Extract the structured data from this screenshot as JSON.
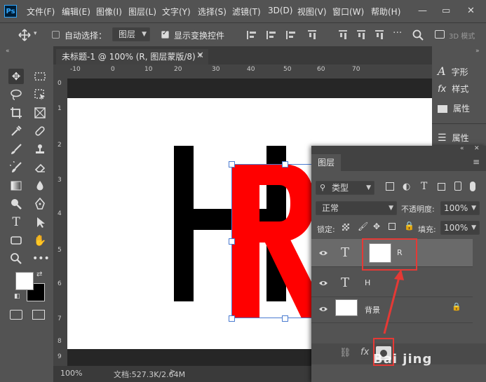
{
  "menubar": {
    "logo": "Ps",
    "items": [
      "文件(F)",
      "编辑(E)",
      "图像(I)",
      "图层(L)",
      "文字(Y)",
      "选择(S)",
      "滤镜(T)",
      "3D(D)",
      "视图(V)",
      "窗口(W)",
      "帮助(H)"
    ]
  },
  "options": {
    "auto_select_label": "自动选择：",
    "auto_select_value": "图层",
    "show_transform_label": "显示变换控件",
    "mode_3d_label": "3D 模式"
  },
  "document": {
    "tab_title": "未标题-1 @ 100% (R, 图层蒙版/8) *",
    "ruler_h": [
      "-10",
      "0",
      "10",
      "20",
      "30",
      "40",
      "50",
      "60",
      "70"
    ],
    "ruler_v": [
      "0",
      "1",
      "2",
      "3",
      "4",
      "5",
      "6",
      "7",
      "8",
      "9"
    ],
    "canvas_letters": [
      "H",
      "R"
    ]
  },
  "status": {
    "zoom": "100%",
    "doc_info": "文档:527.3K/2.64M"
  },
  "right_panel": {
    "items": [
      "字形",
      "样式",
      "属性",
      "属性"
    ]
  },
  "layers": {
    "tab_label": "图层",
    "filter_value": "类型",
    "blend_mode": "正常",
    "opacity_label": "不透明度:",
    "opacity_value": "100%",
    "lock_label": "锁定:",
    "fill_label": "填充:",
    "fill_value": "100%",
    "rows": [
      {
        "name": "R"
      },
      {
        "name": "H"
      },
      {
        "name": "背景"
      }
    ],
    "watermark": "Bai jing"
  },
  "colors": {
    "accent_red": "#ff0000",
    "annotation_red": "#e53935",
    "selection_blue": "#4a7bd0"
  }
}
